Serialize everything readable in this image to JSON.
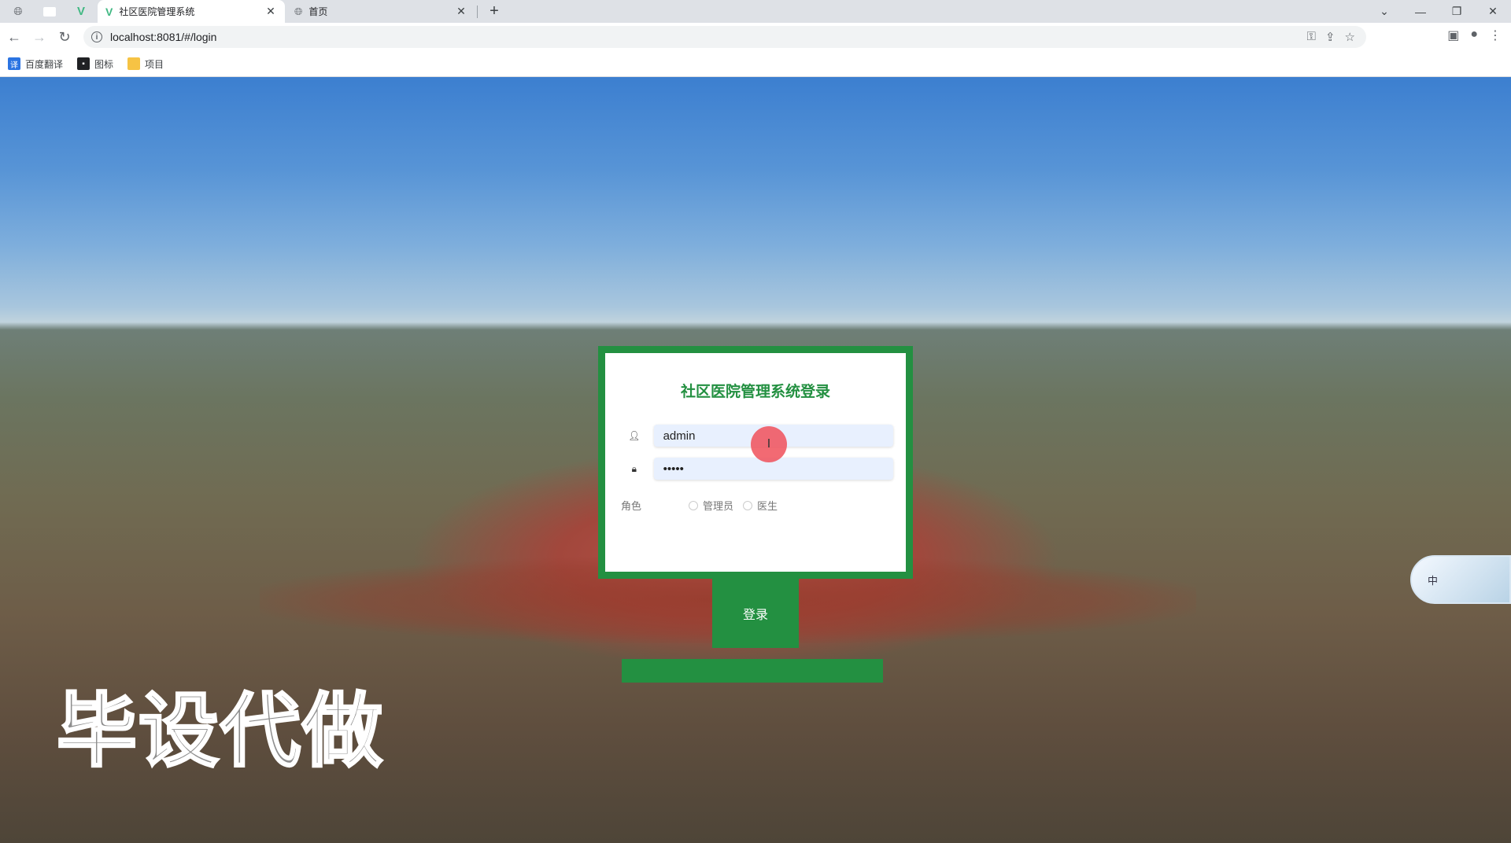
{
  "browser": {
    "tabs": [
      {
        "title": "社区医院管理系统",
        "active": true,
        "icon": "vue-logo-icon"
      },
      {
        "title": "首页",
        "active": false,
        "icon": "globe-icon"
      }
    ],
    "new_tab_label": "+",
    "url": "localhost:8081/#/login",
    "bookmarks": [
      {
        "label": "百度翻译",
        "icon": "translate-icon",
        "color": "#2b74e2"
      },
      {
        "label": "图标",
        "icon": "image-icon",
        "color": "#202124"
      },
      {
        "label": "项目",
        "icon": "folder-icon",
        "color": "#f6c344"
      }
    ]
  },
  "login": {
    "title": "社区医院管理系统登录",
    "username_value": "admin",
    "password_value": "•••••",
    "role_label": "角色",
    "roles": [
      "管理员",
      "医生"
    ],
    "submit_label": "登录",
    "accent_color": "#239041"
  },
  "watermark": "毕设代做",
  "ime": {
    "label": "中"
  }
}
